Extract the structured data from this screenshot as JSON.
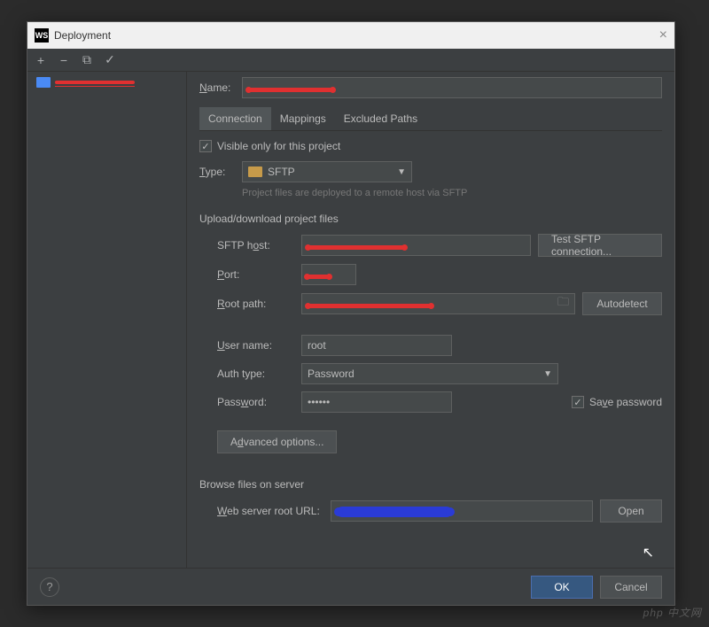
{
  "window": {
    "title": "Deployment",
    "ws": "WS"
  },
  "toolbar": {
    "plus": "+",
    "minus": "−",
    "copy": "⧉",
    "check": "✓"
  },
  "tree": {
    "item_icon": "server"
  },
  "name_label": "Name:",
  "tabs": {
    "connection": "Connection",
    "mappings": "Mappings",
    "excluded": "Excluded Paths"
  },
  "visible_only": "Visible only for this project",
  "type_label": "Type:",
  "type_value": "SFTP",
  "type_hint": "Project files are deployed to a remote host via SFTP",
  "section_upload": "Upload/download project files",
  "sftp_host_label": "SFTP host:",
  "test_btn": "Test SFTP connection...",
  "port_label": "Port:",
  "root_label": "Root path:",
  "autodetect_btn": "Autodetect",
  "user_label": "User name:",
  "user_value": "root",
  "auth_label": "Auth type:",
  "auth_value": "Password",
  "pass_label": "Password:",
  "pass_value": "••••••",
  "save_pass": "Save password",
  "advanced_btn": "Advanced options...",
  "section_browse": "Browse files on server",
  "web_root_label": "Web server root URL:",
  "open_btn": "Open",
  "ok_btn": "OK",
  "cancel_btn": "Cancel",
  "help": "?",
  "watermark": "php 中文网"
}
